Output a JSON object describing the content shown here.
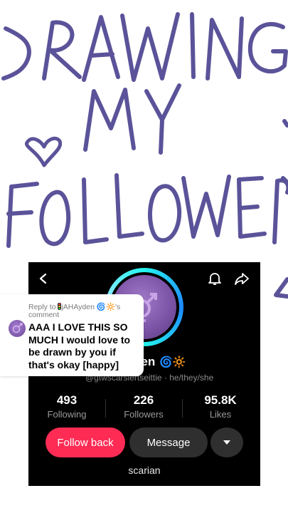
{
  "handwriting": {
    "line1": "DRAWING",
    "line2": "MY",
    "line3": "FOLLOWERS"
  },
  "reply": {
    "prefix": "Reply to",
    "username": "jAHAyden",
    "suffix": "'s comment",
    "text": "AAA I LOVE THIS SO MUCH I would love to be drawn by you if that's okay [happy]"
  },
  "profile": {
    "name_visible": "den",
    "name_emojis": "🌀🔆",
    "handle": "@gtwscarsiertseittie",
    "pronouns": "he/they/she",
    "bio": "scarian",
    "ring_color": "#25f4ee"
  },
  "stats": [
    {
      "value": "493",
      "label": "Following"
    },
    {
      "value": "226",
      "label": "Followers"
    },
    {
      "value": "95.8K",
      "label": "Likes"
    }
  ],
  "buttons": {
    "follow_back": "Follow back",
    "message": "Message"
  },
  "colors": {
    "ink": "#5b5399",
    "follow": "#fe2c55",
    "card": "#000000"
  }
}
